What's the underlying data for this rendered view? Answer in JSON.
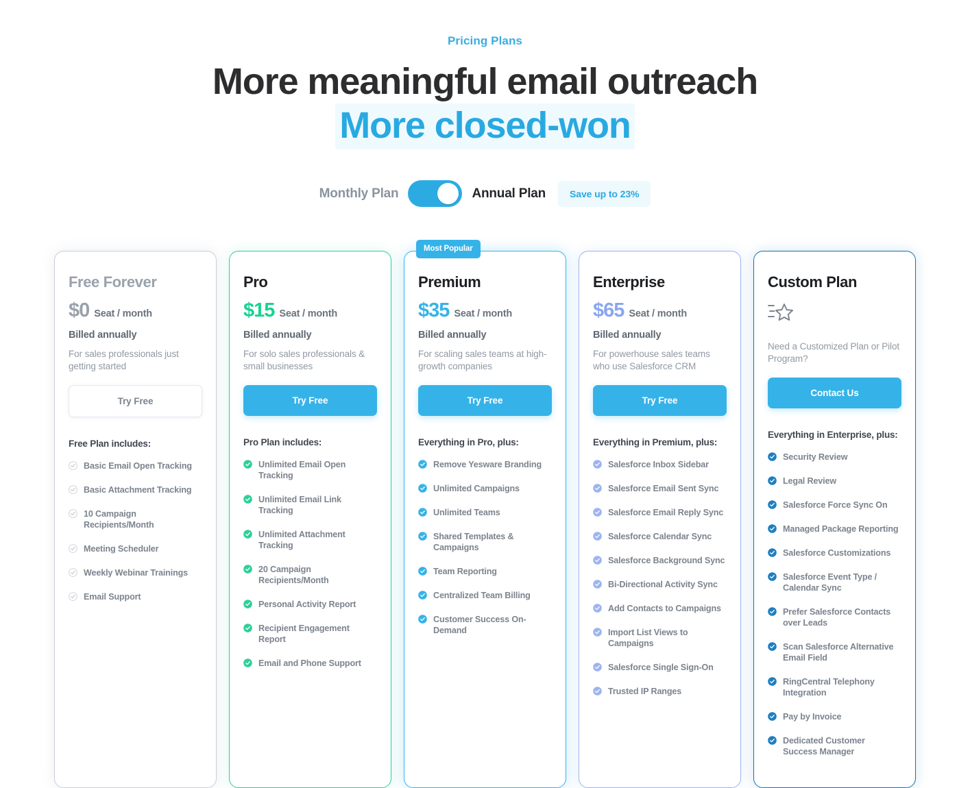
{
  "header": {
    "eyebrow": "Pricing Plans",
    "headline_line1": "More meaningful email outreach",
    "headline_line2": "More closed-won"
  },
  "billing_toggle": {
    "monthly_label": "Monthly Plan",
    "annual_label": "Annual Plan",
    "save_badge": "Save up to 23%",
    "state": "annual",
    "accent_color": "#2cabe3"
  },
  "plans": [
    {
      "name": "Free Forever",
      "price": "$0",
      "price_unit": "Seat / month",
      "price_color": "#9aa2ac",
      "billing_note": "Billed annually",
      "blurb": "For sales professionals just getting started",
      "cta_label": "Try Free",
      "cta_style": "outline",
      "badge": "",
      "includes_head": "Free Plan includes:",
      "check_color": "#c9ced6",
      "border_color": "#c9ced6",
      "features": [
        "Basic Email Open Tracking",
        "Basic Attachment Tracking",
        "10 Campaign Recipients/Month",
        "Meeting Scheduler",
        "Weekly Webinar Trainings",
        "Email Support"
      ]
    },
    {
      "name": "Pro",
      "price": "$15",
      "price_unit": "Seat / month",
      "price_color": "#17d392",
      "billing_note": "Billed annually",
      "blurb": "For solo sales professionals & small businesses",
      "cta_label": "Try Free",
      "cta_style": "solid",
      "badge": "",
      "includes_head": "Pro Plan includes:",
      "check_color": "#2fcf9a",
      "border_color": "#2fcf9a",
      "features": [
        "Unlimited Email Open Tracking",
        "Unlimited Email Link Tracking",
        "Unlimited Attachment Tracking",
        "20 Campaign Recipients/Month",
        "Personal Activity Report",
        "Recipient Engagement Report",
        "Email and Phone Support"
      ]
    },
    {
      "name": "Premium",
      "price": "$35",
      "price_unit": "Seat / month",
      "price_color": "#35b3e8",
      "billing_note": "Billed annually",
      "blurb": "For scaling sales teams at high-growth companies",
      "cta_label": "Try Free",
      "cta_style": "solid",
      "badge": "Most Popular",
      "includes_head": "Everything in Pro, plus:",
      "check_color": "#35b3e8",
      "border_color": "#35b3e8",
      "features": [
        "Remove Yesware Branding",
        "Unlimited Campaigns",
        "Unlimited Teams",
        "Shared Templates & Campaigns",
        "Team Reporting",
        "Centralized Team Billing",
        "Customer Success On-Demand"
      ]
    },
    {
      "name": "Enterprise",
      "price": "$65",
      "price_unit": "Seat / month",
      "price_color": "#8aa6f0",
      "billing_note": "Billed annually",
      "blurb": "For powerhouse sales teams who use Salesforce CRM",
      "cta_label": "Try Free",
      "cta_style": "solid",
      "badge": "",
      "includes_head": "Everything in Premium, plus:",
      "check_color": "#9db4ef",
      "border_color": "#9db4ef",
      "features": [
        "Salesforce Inbox Sidebar",
        "Salesforce Email Sent Sync",
        "Salesforce Email Reply Sync",
        "Salesforce Calendar Sync",
        "Salesforce Background Sync",
        "Bi-Directional Activity Sync",
        "Add Contacts to Campaigns",
        "Import List Views to Campaigns",
        "Salesforce Single Sign-On",
        "Trusted IP Ranges"
      ]
    },
    {
      "name": "Custom Plan",
      "price": "",
      "price_unit": "",
      "price_color": "#7c848f",
      "billing_note": "",
      "icon": "shooting-star-icon",
      "blurb": "Need a Customized Plan or Pilot Program?",
      "cta_label": "Contact Us",
      "cta_style": "solid",
      "badge": "",
      "includes_head": "Everything in Enterprise, plus:",
      "check_color": "#1f7fc0",
      "border_color": "#1372ad",
      "features": [
        "Security Review",
        "Legal Review",
        "Salesforce Force Sync On",
        "Managed Package Reporting",
        "Salesforce Customizations",
        "Salesforce Event Type / Calendar Sync",
        "Prefer Salesforce Contacts over Leads",
        "Scan Salesforce Alternative Email Field",
        "RingCentral Telephony Integration",
        "Pay by Invoice",
        "Dedicated Customer Success Manager"
      ]
    }
  ]
}
